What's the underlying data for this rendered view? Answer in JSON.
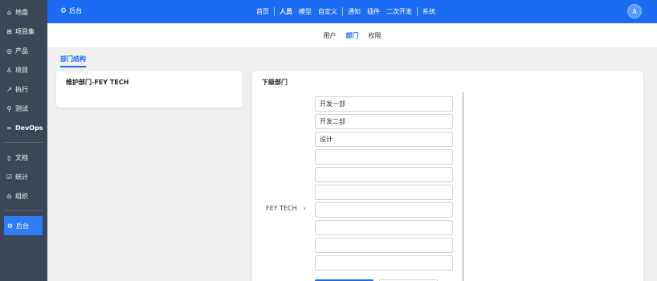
{
  "sidebar": {
    "items": [
      {
        "label": "地盘",
        "icon": "home-icon"
      },
      {
        "label": "项目集",
        "icon": "grid-icon"
      },
      {
        "label": "产品",
        "icon": "target-icon"
      },
      {
        "label": "项目",
        "icon": "bell-icon"
      },
      {
        "label": "执行",
        "icon": "run-icon"
      },
      {
        "label": "测试",
        "icon": "search-icon"
      },
      {
        "label": "DevOps",
        "icon": "infinity-icon"
      },
      {
        "label": "文档",
        "icon": "book-icon"
      },
      {
        "label": "统计",
        "icon": "chart-icon"
      },
      {
        "label": "组织",
        "icon": "people-icon"
      },
      {
        "label": "后台",
        "icon": "gear-icon"
      }
    ]
  },
  "header": {
    "brand": "后台",
    "nav": [
      "首页",
      "人员",
      "模型",
      "自定义",
      "通知",
      "插件",
      "二次开发",
      "系统"
    ],
    "avatar": "A"
  },
  "subnav": [
    "用户",
    "部门",
    "权限"
  ],
  "tab": "部门结构",
  "left_card": {
    "title": "维护部门-FEY TECH"
  },
  "right_card": {
    "title": "下级部门",
    "parent": "FEY TECH",
    "departments": [
      "开发一部",
      "开发二部",
      "设计",
      "",
      "",
      "",
      "",
      "",
      "",
      ""
    ]
  },
  "colors": {
    "accent": "#1b6cf2",
    "sidebar": "#3b4658"
  }
}
